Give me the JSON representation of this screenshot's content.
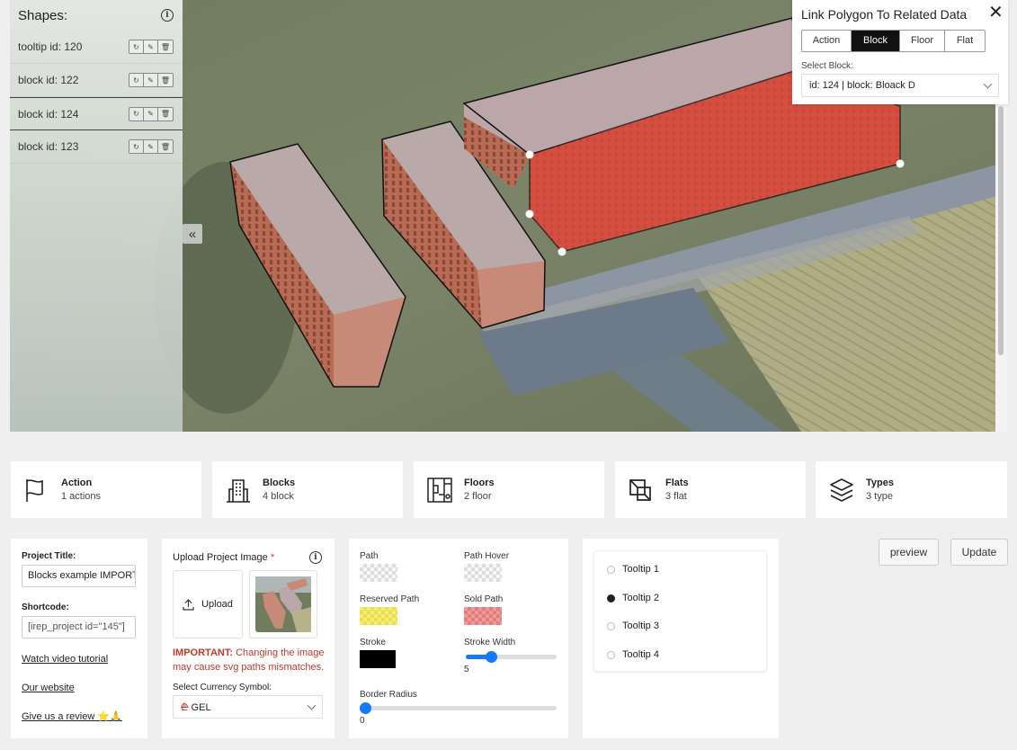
{
  "sidebar": {
    "title": "Shapes:",
    "items": [
      {
        "label": "tooltip id: 120"
      },
      {
        "label": "block id: 122"
      },
      {
        "label": "block id: 124"
      },
      {
        "label": "block id: 123"
      }
    ],
    "collapse_glyph": "«"
  },
  "link_panel": {
    "title": "Link Polygon To Related Data",
    "tabs": [
      "Action",
      "Block",
      "Floor",
      "Flat"
    ],
    "active_tab": "Block",
    "select_label": "Select Block:",
    "select_value": "id: 124 | block: Bloack D"
  },
  "stats": [
    {
      "title": "Action",
      "sub": "1 actions",
      "icon": "flag-icon"
    },
    {
      "title": "Blocks",
      "sub": "4 block",
      "icon": "building-icon"
    },
    {
      "title": "Floors",
      "sub": "2 floor",
      "icon": "floors-icon"
    },
    {
      "title": "Flats",
      "sub": "3 flat",
      "icon": "flats-icon"
    },
    {
      "title": "Types",
      "sub": "3 type",
      "icon": "layers-icon"
    }
  ],
  "project": {
    "title_label": "Project Title:",
    "title_value": "Blocks example IMPORT",
    "shortcode_label": "Shortcode:",
    "shortcode_value": "[irep_project id=\"145\"]",
    "links": [
      "Watch video tutorial",
      "Our website",
      "Give us a review ⭐🙏"
    ]
  },
  "upload": {
    "label": "Upload Project Image",
    "required": "*",
    "button": "Upload",
    "warning_strong": "IMPORTANT:",
    "warning_text": "Changing the image may cause svg paths mismatches.",
    "currency_label": "Select Currency Symbol:",
    "currency_symbol": "₾",
    "currency_value": "GEL"
  },
  "styles": {
    "path": "Path",
    "path_hover": "Path Hover",
    "reserved_path": "Reserved Path",
    "sold_path": "Sold Path",
    "stroke": "Stroke",
    "stroke_width": "Stroke Width",
    "stroke_width_value": "5",
    "border_radius": "Border Radius",
    "border_radius_value": "0",
    "colors": {
      "stroke": "#000000",
      "accent": "#1677ff",
      "reserved": "#f6ed6f",
      "sold": "#f09a9a",
      "polygon_fill": "#e0453a"
    }
  },
  "tooltips": {
    "options": [
      "Tooltip 1",
      "Tooltip 2",
      "Tooltip 3",
      "Tooltip 4"
    ],
    "selected": "Tooltip 2"
  },
  "buttons": {
    "preview": "preview",
    "update": "Update"
  }
}
